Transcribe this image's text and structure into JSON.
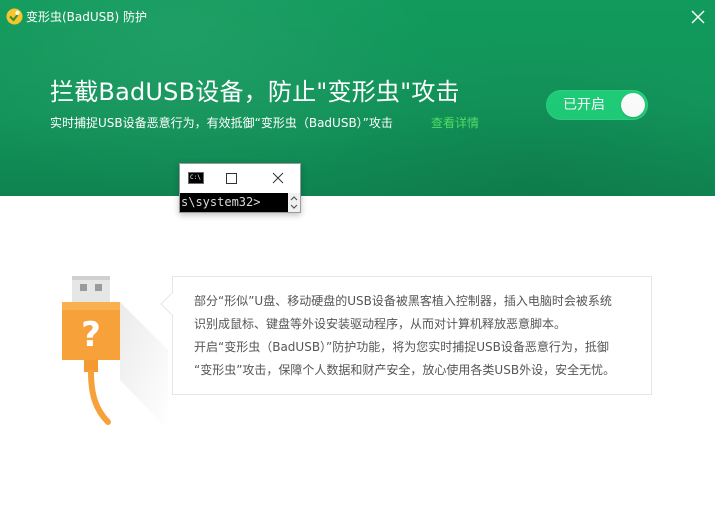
{
  "window": {
    "title": "变形虫(BadUSB) 防护",
    "close_icon": "close-icon"
  },
  "banner": {
    "headline": "拦截BadUSB设备，防止\"变形虫\"攻击",
    "subline": "实时捕捉USB设备恶意行为，有效抵御“变形虫（BadUSB）”攻击",
    "detail_link": "查看详情",
    "toggle": {
      "label": "已开启",
      "state": "on"
    }
  },
  "cmd_window": {
    "icon_text": "C:\\",
    "console_text": "s\\system32>"
  },
  "info": {
    "paragraph1_line1": "部分“形似”U盘、移动硬盘的USB设备被黑客植入控制器，插入电脑时会被系统",
    "paragraph1_line2": "识别成鼠标、键盘等外设安装驱动程序，从而对计算机释放恶意脚本。",
    "paragraph2_line1": "开启“变形虫（BadUSB）”防护功能，将为您实时捕捉USB设备恶意行为，抵御",
    "paragraph2_line2": "“变形虫”攻击，保障个人数据和财产安全，放心使用各类USB外设，安全无忧。"
  },
  "colors": {
    "banner_green": "#12945a",
    "toggle_green": "#1fd07a",
    "link_green": "#55e26a",
    "usb_orange": "#f7a13a",
    "text_gray": "#555555"
  },
  "icons": {
    "app": "shield-logo-icon",
    "usb": "usb-question-icon"
  }
}
